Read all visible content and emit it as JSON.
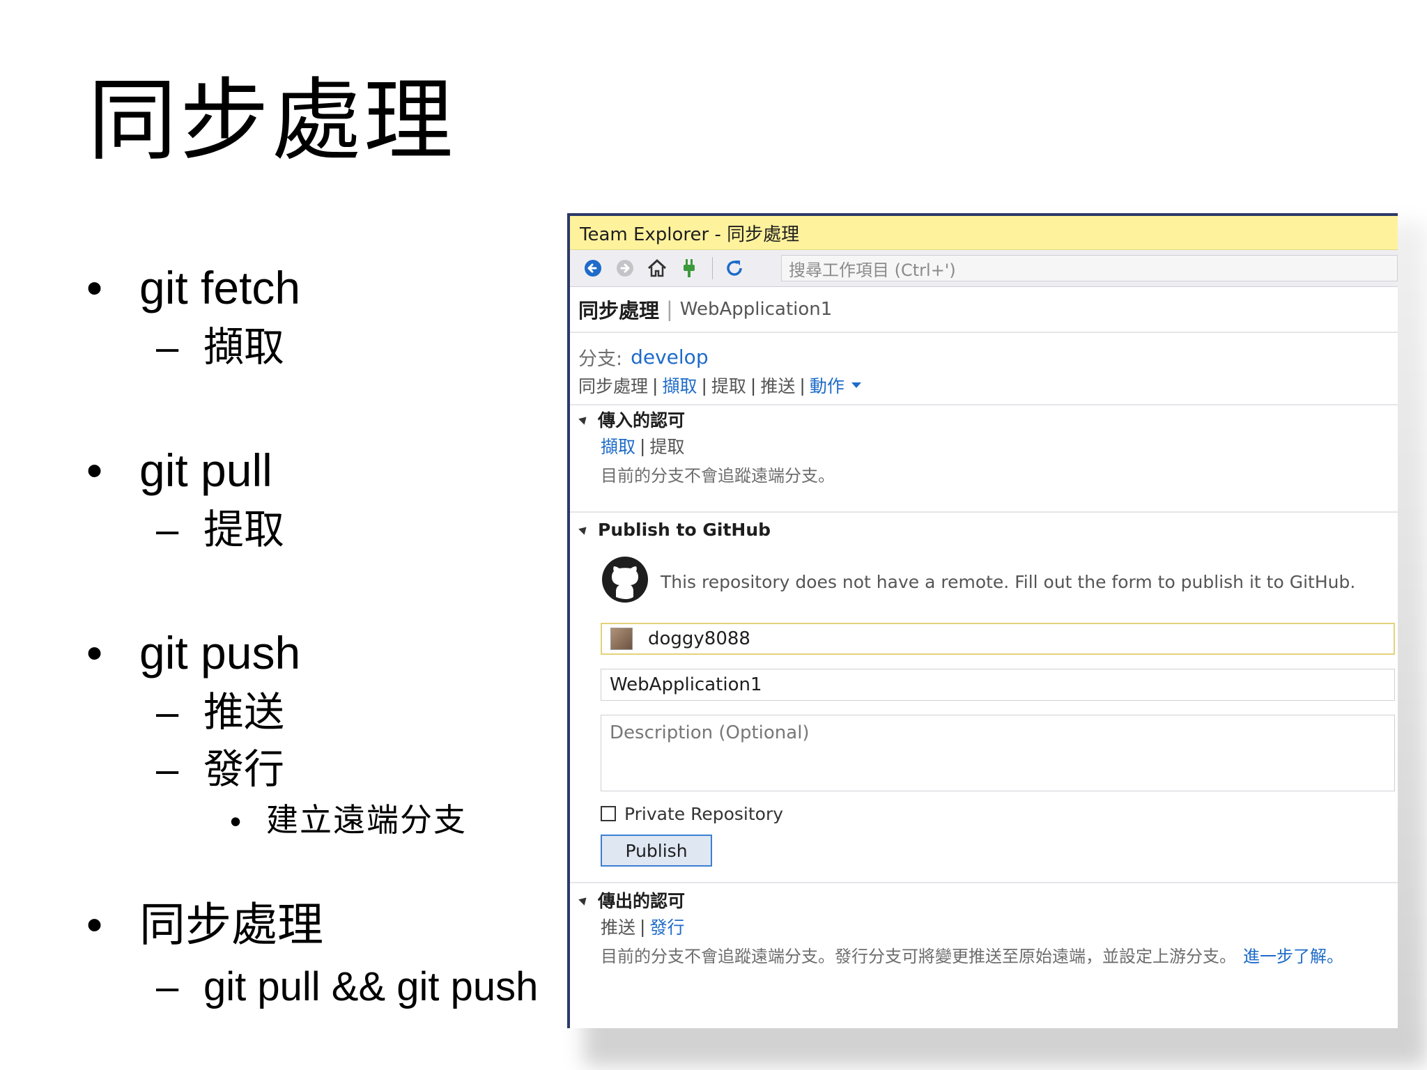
{
  "slide": {
    "title": "同步處理",
    "bullets": [
      {
        "mark": "•",
        "text": "git fetch",
        "sub": [
          {
            "mark": "–",
            "text": "擷取"
          }
        ]
      },
      {
        "mark": "•",
        "text": "git pull",
        "sub": [
          {
            "mark": "–",
            "text": "提取"
          }
        ]
      },
      {
        "mark": "•",
        "text": "git push",
        "sub": [
          {
            "mark": "–",
            "text": "推送"
          },
          {
            "mark": "–",
            "text": "發行"
          }
        ],
        "subsub": [
          {
            "mark": "•",
            "text": "建立遠端分支"
          }
        ]
      },
      {
        "mark": "•",
        "text": "同步處理",
        "sub": [
          {
            "mark": "–",
            "text": "git pull && git push"
          }
        ]
      }
    ]
  },
  "team_explorer": {
    "window_title": "Team Explorer - 同步處理",
    "search_placeholder": "搜尋工作項目 (Ctrl+')",
    "toolbar_icons": [
      "back-arrow-icon",
      "forward-arrow-icon",
      "home-icon",
      "plug-icon",
      "refresh-icon"
    ],
    "page_name": "同步處理",
    "page_separator": "|",
    "repo_name": "WebApplication1",
    "branch_label": "分支:",
    "branch_name": "develop",
    "actions": {
      "sync": "同步處理",
      "fetch": "擷取",
      "pull": "提取",
      "push": "推送",
      "more": "動作"
    },
    "incoming": {
      "header": "傳入的認可",
      "fetch": "擷取",
      "pull": "提取",
      "message": "目前的分支不會追蹤遠端分支。"
    },
    "publish": {
      "header": "Publish to GitHub",
      "message": "This repository does not have a remote. Fill out the form to publish it to GitHub.",
      "username": "doggy8088",
      "repository": "WebApplication1",
      "description_placeholder": "Description (Optional)",
      "private_label": "Private Repository",
      "private_checked": false,
      "button": "Publish"
    },
    "outgoing": {
      "header": "傳出的認可",
      "push": "推送",
      "publish": "發行",
      "message": "目前的分支不會追蹤遠端分支。發行分支可將變更推送至原始遠端，並設定上游分支。",
      "learn_more": "進一步了解。"
    },
    "colors": {
      "title_bar": "#fff29d",
      "link": "#1e6bc9",
      "toolbar_blue": "#1e6bc9",
      "plug_green": "#3c9a3c"
    }
  }
}
